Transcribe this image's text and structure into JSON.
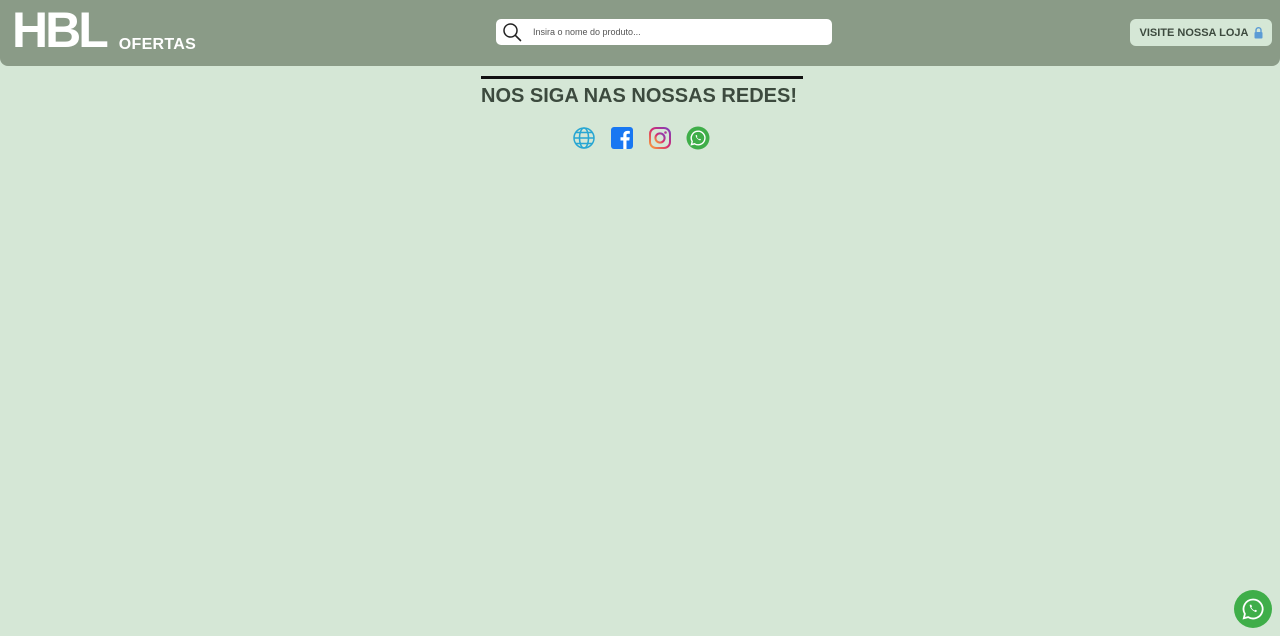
{
  "header": {
    "brand_logo": "HBL",
    "brand_tag": "OFERTAS",
    "search": {
      "placeholder": "Insira o nome do produto...",
      "value": ""
    },
    "store_button_label": "VISITE NOSSA LOJA"
  },
  "social": {
    "title": "NOS SIGA NAS NOSSAS REDES!",
    "icons": [
      "globe-icon",
      "facebook-icon",
      "instagram-icon",
      "whatsapp-icon"
    ]
  },
  "floating": {
    "icon": "whatsapp-icon"
  },
  "colors": {
    "background": "#d5e7d6",
    "header": "#8a9b87",
    "facebook": "#1877f2",
    "whatsapp": "#3fae49",
    "globe": "#27a6d3"
  }
}
